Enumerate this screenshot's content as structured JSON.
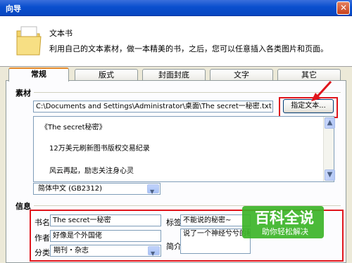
{
  "window": {
    "title": "向导"
  },
  "header": {
    "title": "文本书",
    "description": "利用自己的文本素材，做一本精美的书，之后，您可以任意插入各类图片和页面。"
  },
  "tabs": [
    {
      "label": "常规",
      "active": true
    },
    {
      "label": "版式",
      "active": false
    },
    {
      "label": "封面封底",
      "active": false
    },
    {
      "label": "文字",
      "active": false
    },
    {
      "label": "其它",
      "active": false
    }
  ],
  "material": {
    "section_label": "素材",
    "file_path": "C:\\Documents and Settings\\Administrator\\桌面\\The secret一秘密.txt",
    "choose_button": "指定文本...",
    "content_lines": [
      "《The secret秘密》",
      "12万美元刷新图书版权交易纪录",
      "风云再起，励志关注身心灵"
    ],
    "encoding": "简体中文 (GB2312)"
  },
  "info": {
    "section_label": "信息",
    "book_name_label": "书名",
    "book_name": "The secret一秘密",
    "author_label": "作者",
    "author": "好像是个外国佬",
    "category_label": "分类",
    "category": "期刊・杂志",
    "tag_label": "标签",
    "tag": "不能说的秘密~",
    "intro_label": "简介",
    "intro": "说了一个神经兮兮的秘"
  },
  "watermark": {
    "brand": "百科全说",
    "slogan": "助你轻松解决"
  },
  "colors": {
    "titlebar": "#0a4fce",
    "highlight": "#e0151c",
    "tab_accent": "#e68b2c",
    "badge": "#3cb428"
  }
}
